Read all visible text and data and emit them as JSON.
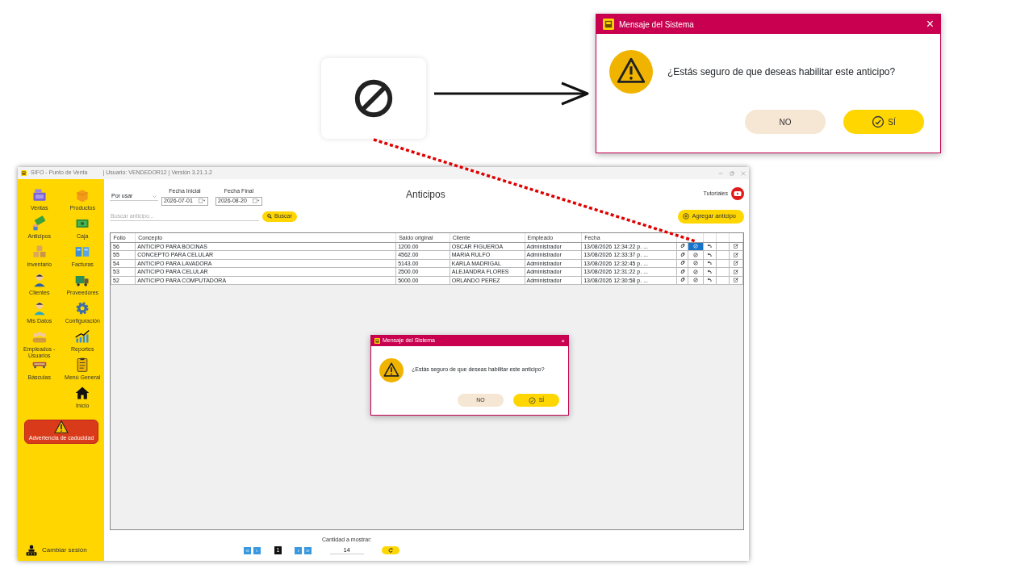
{
  "zoomed_dialog": {
    "title": "Mensaje del Sistema",
    "close": "×",
    "message": "¿Estás seguro de que deseas habilitar este anticipo?",
    "buttons": [
      {
        "label": "NO",
        "kind": "cancel"
      },
      {
        "label": "SÍ",
        "kind": "confirm"
      }
    ]
  },
  "window": {
    "title": "SIFO - Punto de Venta",
    "subtitle": "| Usuario: VENDEDOR12 | Versión 3.21.1.2"
  },
  "sidebar": {
    "items": [
      {
        "label": "Ventas"
      },
      {
        "label": "Productos"
      },
      {
        "label": "Anticipos"
      },
      {
        "label": "Caja"
      },
      {
        "label": "Inventario"
      },
      {
        "label": "Facturas"
      },
      {
        "label": "Clientes"
      },
      {
        "label": "Proveedores"
      },
      {
        "label": "Mis Datos"
      },
      {
        "label": "Configuración"
      },
      {
        "label": "Empleados - Usuarios"
      },
      {
        "label": "Reportes"
      },
      {
        "label": "Básculas"
      },
      {
        "label": "Menú General"
      },
      {
        "label": "Inicio"
      }
    ],
    "alert": "Advertencia de caducidad",
    "footer": "Cambiar sesión"
  },
  "page": {
    "title": "Anticipos",
    "tutorials": "Tutoriales",
    "add_button": "Agregar anticipo"
  },
  "filters": {
    "status": "Por usar",
    "start_label": "Fecha Inicial",
    "start_value": "2026-07-01",
    "end_label": "Fecha Final",
    "end_value": "2026-08-20",
    "search_placeholder": "Buscar anticipo...",
    "search_button": "Buscar"
  },
  "table": {
    "columns": [
      "Folio",
      "Concepto",
      "Saldo original",
      "Cliente",
      "Empleado",
      "Fecha"
    ],
    "rows": [
      {
        "cells": [
          "56",
          "ANTICIPO PARA BOCINAS",
          "1200.00",
          "OSCAR FIGUEROA",
          "Administrador",
          "13/08/2026 12:34:22 p. ..."
        ],
        "selected": true
      },
      {
        "cells": [
          "55",
          "CONCEPTO PARA CELULAR",
          "4562.00",
          "MARIA RULFO",
          "Administrador",
          "13/08/2026 12:33:37 p. ..."
        ],
        "selected": false
      },
      {
        "cells": [
          "54",
          "ANTICIPO PARA LAVADORA",
          "5143.00",
          "KARLA MADRIGAL",
          "Administrador",
          "13/08/2026 12:32:45 p. ..."
        ],
        "selected": false
      },
      {
        "cells": [
          "53",
          "ANTICIPO PARA CELULAR",
          "2500.00",
          "ALEJANDRA FLORES",
          "Administrador",
          "13/08/2026 12:31:22 p. ..."
        ],
        "selected": false
      },
      {
        "cells": [
          "52",
          "ANTICIPO PARA COMPUTADORA",
          "5000.00",
          "ORLANDO PEREZ",
          "Administrador",
          "13/08/2026 12:30:58 p. ..."
        ],
        "selected": false
      }
    ]
  },
  "dialog": {
    "title": "Mensaje del Sistema",
    "close": "×",
    "message": "¿Estás seguro de que deseas habilitar este anticipo?",
    "buttons": [
      {
        "label": "NO",
        "kind": "cancel"
      },
      {
        "label": "SÍ",
        "kind": "confirm"
      }
    ]
  },
  "pager": {
    "page": "1",
    "count_label": "Cantidad a mostrar:",
    "count": "14"
  }
}
